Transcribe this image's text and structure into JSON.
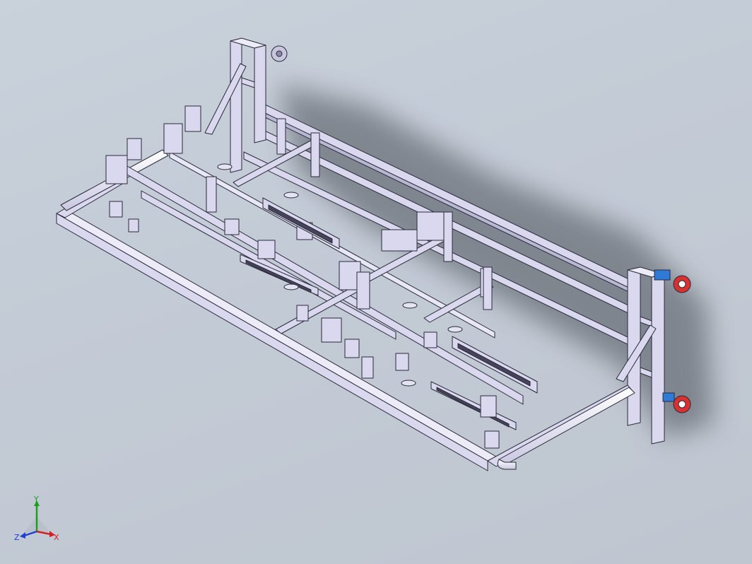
{
  "viewport": {
    "background_color": "#c5ccd6",
    "frame_color": "#d9d8ee",
    "edge_color": "#2a2a3a",
    "accent_colors": {
      "caster_red": "#d93030",
      "caster_blue": "#2f7ad6"
    }
  },
  "triad": {
    "x_label": "X",
    "y_label": "Y",
    "z_label": "Z",
    "x_color": "#d42020",
    "y_color": "#1aa01a",
    "z_color": "#2040d0"
  }
}
